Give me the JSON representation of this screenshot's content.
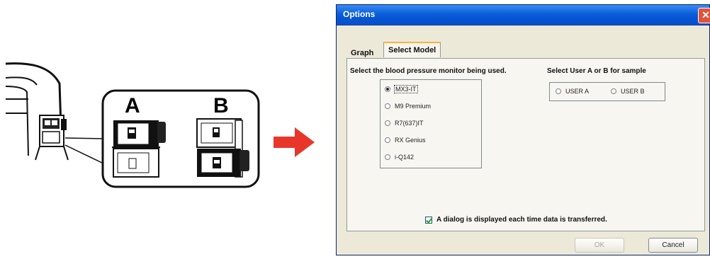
{
  "illustration": {
    "label_a": "A",
    "label_b": "B",
    "arrow_color": "#e8362b"
  },
  "dialog": {
    "title": "Options",
    "close_glyph": "✕",
    "tabs": [
      {
        "label": "Graph",
        "active": false
      },
      {
        "label": "Select Model",
        "active": true
      }
    ],
    "monitor_heading": "Select the blood pressure monitor being used.",
    "user_heading": "Select User A or B for sample",
    "models": [
      {
        "label": "MX3-IT",
        "checked": true
      },
      {
        "label": "M9 Premium",
        "checked": false
      },
      {
        "label": "R7(637)IT",
        "checked": false
      },
      {
        "label": "RX Genius",
        "checked": false
      },
      {
        "label": "i-Q142",
        "checked": false
      }
    ],
    "users": [
      {
        "label": "USER A",
        "checked": false
      },
      {
        "label": "USER B",
        "checked": false
      }
    ],
    "checkbox_label": "A dialog is displayed each time data is transferred.",
    "checkbox_checked": true,
    "ok_label": "OK",
    "cancel_label": "Cancel"
  }
}
